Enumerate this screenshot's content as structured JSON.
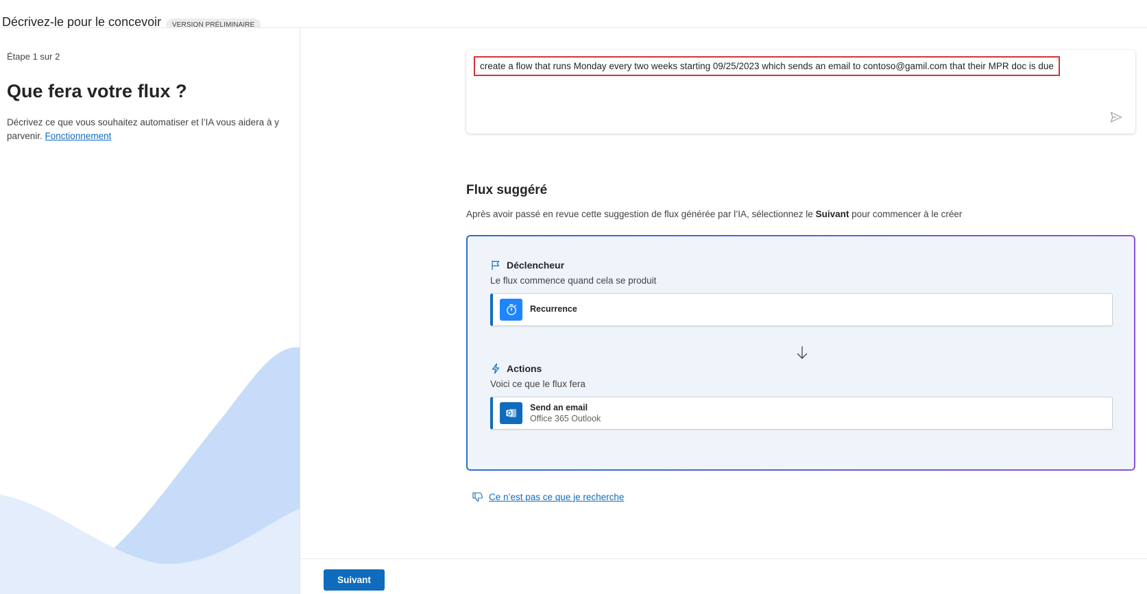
{
  "header": {
    "title": "Décrivez-le pour le concevoir",
    "badge": "VERSION PRÉLIMINAIRE"
  },
  "left_panel": {
    "step": "Étape 1 sur 2",
    "heading": "Que fera votre flux ?",
    "description": "Décrivez ce que vous souhaitez automatiser et l’IA vous aidera à y parvenir.",
    "link_label": "Fonctionnement"
  },
  "prompt": {
    "text": "create a flow that runs Monday every two weeks starting 09/25/2023 which sends an email to contoso@gamil.com that their MPR doc is due",
    "send_icon": "send-icon"
  },
  "suggested_flow": {
    "title": "Flux suggéré",
    "description_before": "Après avoir passé en revue cette suggestion de flux générée par l’IA, sélectionnez le ",
    "description_bold": "Suivant",
    "description_after": " pour commencer à le créer",
    "trigger": {
      "label": "Déclencheur",
      "icon": "flag-icon",
      "subtitle": "Le flux commence quand cela se produit",
      "card": {
        "name": "Recurrence",
        "icon": "timer-icon",
        "icon_color": "#1f85ff"
      }
    },
    "actions": {
      "label": "Actions",
      "icon": "lightning-icon",
      "subtitle": "Voici ce que le flux fera",
      "card": {
        "name": "Send an email",
        "connector": "Office 365 Outlook",
        "icon": "outlook-icon",
        "icon_color": "#0f6cbd"
      }
    }
  },
  "feedback_link": "Ce n’est pas ce que je recherche",
  "footer": {
    "next_label": "Suivant"
  },
  "colors": {
    "accent": "#0f6cbd",
    "highlight_border": "#d13438",
    "flow_bg": "#eff4fb",
    "wave_light": "#e3edfb",
    "wave_dark": "#c6dcf8"
  }
}
